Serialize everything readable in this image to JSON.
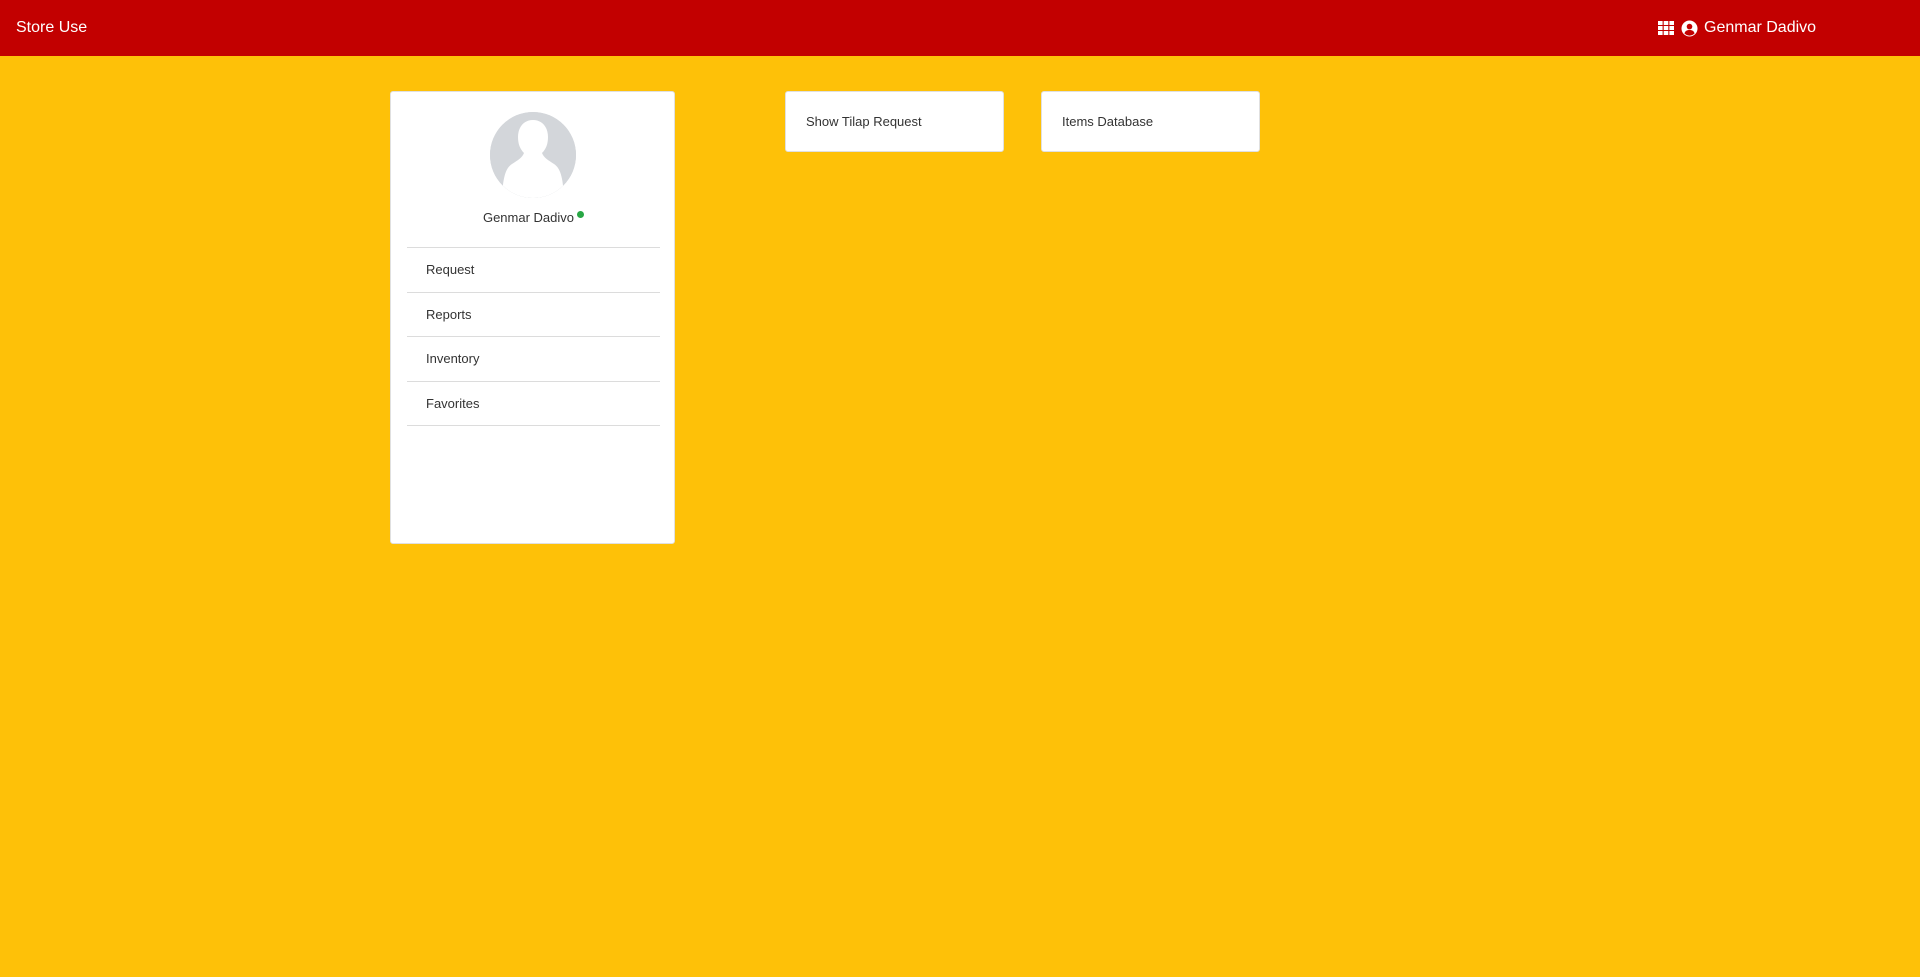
{
  "theme": {
    "navbar_bg": "#c20000",
    "page_bg": "#fec108",
    "status_online": "#28a745"
  },
  "navbar": {
    "brand": "Store Use",
    "apps_icon": "grid-icon",
    "user_icon": "user-circle-icon",
    "user_name": "Genmar Dadivo"
  },
  "profile": {
    "avatar_icon": "avatar-silhouette-icon",
    "name": "Genmar Dadivo",
    "status": "online",
    "menu": [
      {
        "label": "Request"
      },
      {
        "label": "Reports"
      },
      {
        "label": "Inventory"
      },
      {
        "label": "Favorites"
      }
    ]
  },
  "tiles": [
    {
      "label": "Show Tilap Request"
    },
    {
      "label": "Items Database"
    }
  ]
}
